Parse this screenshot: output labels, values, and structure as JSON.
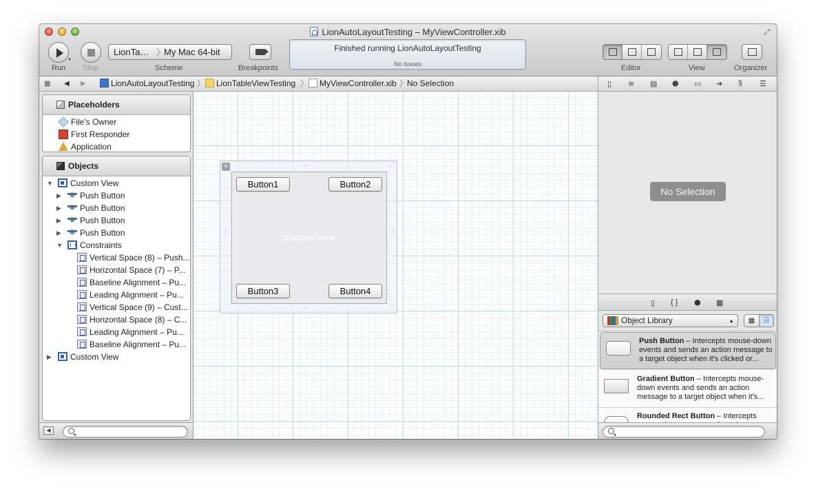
{
  "window": {
    "title": "LionAutoLayoutTesting – MyViewController.xib"
  },
  "toolbar": {
    "run_label": "Run",
    "stop_label": "Stop",
    "scheme_label": "Scheme",
    "scheme_target": "LionTa…",
    "scheme_sep": "〉",
    "scheme_destination": "My Mac 64-bit",
    "breakpoints_label": "Breakpoints",
    "activity_status": "Finished running LionAutoLayoutTesting",
    "activity_issues": "No Issues",
    "editor_label": "Editor",
    "view_label": "View",
    "organizer_label": "Organizer"
  },
  "jumpbar": {
    "crumbs": [
      "LionAutoLayoutTesting",
      "LionTableViewTesting",
      "MyViewController.xib",
      "No Selection"
    ],
    "chevron": "〉"
  },
  "navigator": {
    "placeholders_title": "Placeholders",
    "placeholders": [
      "File's Owner",
      "First Responder",
      "Application"
    ],
    "objects_title": "Objects",
    "tree": [
      {
        "label": "Custom View",
        "expanded": true
      },
      {
        "label": "Push Button"
      },
      {
        "label": "Push Button"
      },
      {
        "label": "Push Button"
      },
      {
        "label": "Push Button"
      },
      {
        "label": "Constraints",
        "expanded": true
      },
      {
        "label": "Vertical Space (8) – Push..."
      },
      {
        "label": "Horizontal Space (7) – P..."
      },
      {
        "label": "Baseline Alignment – Pu..."
      },
      {
        "label": "Leading Alignment – Pu..."
      },
      {
        "label": "Vertical Space (9) – Cust..."
      },
      {
        "label": "Horizontal Space (8) – C..."
      },
      {
        "label": "Leading Alignment – Pu..."
      },
      {
        "label": "Baseline Alignment – Pu..."
      },
      {
        "label": "Custom View"
      }
    ],
    "search_placeholder": ""
  },
  "canvas": {
    "view_label": "Custom View",
    "buttons": [
      "Button1",
      "Button2",
      "Button3",
      "Button4"
    ]
  },
  "inspector": {
    "no_selection": "No Selection"
  },
  "library": {
    "popup_label": "Object Library",
    "items": [
      {
        "name": "Push Button",
        "desc": " – Intercepts mouse-down events and sends an action message to a target object when it's clicked or..."
      },
      {
        "name": "Gradient Button",
        "desc": " – Intercepts mouse-down events and sends an action message to a target object when it's..."
      },
      {
        "name": "Rounded Rect Button",
        "desc": " – Intercepts mouse-down events and sends an..."
      }
    ],
    "search_placeholder": ""
  },
  "colors": {
    "accent": "#2f62b3",
    "no_selection_badge": "#8e8e8e"
  }
}
